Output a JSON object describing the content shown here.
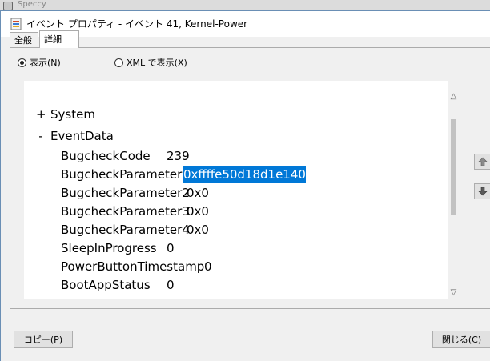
{
  "background_app": {
    "title": "Speccy"
  },
  "window": {
    "title": "イベント プロパティ - イベント 41, Kernel-Power"
  },
  "tabs": [
    {
      "label": "全般"
    },
    {
      "label": "詳細"
    }
  ],
  "view_options": {
    "friendly": "表示(N)",
    "xml": "XML で表示(X)",
    "selected": "friendly"
  },
  "tree": {
    "system": {
      "toggle": "+",
      "label": "System"
    },
    "eventdata": {
      "toggle": "-",
      "label": "EventData"
    },
    "fields": [
      {
        "name": "BugcheckCode",
        "value": "239"
      },
      {
        "name": "BugcheckParameter1",
        "value": "0xffffe50d18d1e140",
        "selected": true
      },
      {
        "name": "BugcheckParameter2",
        "value": "0x0"
      },
      {
        "name": "BugcheckParameter3",
        "value": "0x0"
      },
      {
        "name": "BugcheckParameter4",
        "value": "0x0"
      },
      {
        "name": "SleepInProgress",
        "value": "0"
      },
      {
        "name": "PowerButtonTimestamp",
        "value": "0"
      },
      {
        "name": "BootAppStatus",
        "value": "0"
      }
    ]
  },
  "buttons": {
    "copy": "コピー(P)",
    "close": "閉じる(C)"
  },
  "icons": {
    "prev": "up-arrow-icon",
    "next": "down-arrow-icon"
  },
  "colors": {
    "selection": "#0078d7",
    "dialog_bg": "#f0f0f0"
  }
}
